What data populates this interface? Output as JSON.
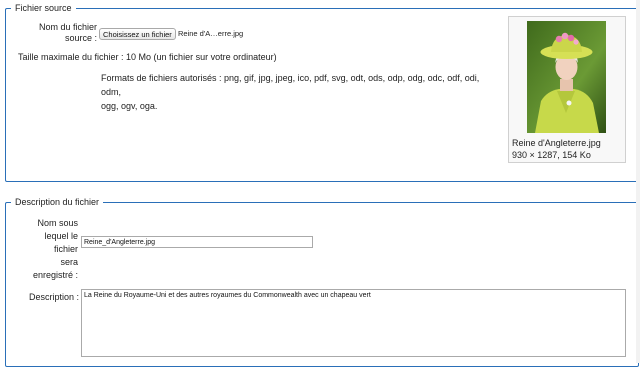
{
  "source_section": {
    "legend": "Fichier source",
    "file_label_line1": "Nom du fichier",
    "file_label_line2": "source :",
    "choose_button": "Choisissez un fichier",
    "chosen_file": "Reine d'A…erre.jpg",
    "max_size": "Taille maximale du fichier : 10 Mo (un fichier sur votre ordinateur)",
    "formats_line1": "Formats de fichiers autorisés : png, gif, jpg, jpeg, ico, pdf, svg, odt, ods, odp, odg, odc, odf, odi, odm,",
    "formats_line2": "ogg, ogv, oga.",
    "preview": {
      "filename": "Reine d'Angleterre.jpg",
      "details": "930 × 1287, 154 Ko"
    }
  },
  "description_section": {
    "legend": "Description du fichier",
    "dest_label": [
      "Nom sous",
      "lequel le fichier",
      "sera",
      "enregistré :"
    ],
    "dest_value": "Reine_d'Angleterre.jpg",
    "description_label": "Description :",
    "description_value": "La Reine du Royaume-Uni et des autres royaumes du Commonwealth avec un chapeau vert"
  }
}
